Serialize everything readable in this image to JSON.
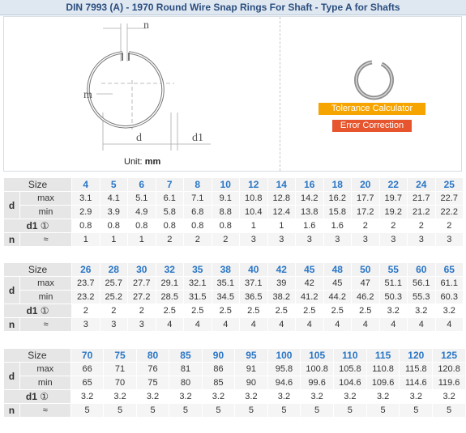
{
  "title": "DIN 7993 (A) - 1970 Round Wire Snap Rings For Shaft - Type A for Shafts",
  "diagram": {
    "labels": [
      "m",
      "n",
      "d",
      "d1"
    ],
    "unit_label": "Unit:",
    "unit_value": "mm"
  },
  "buttons": {
    "tolerance_calculator": "Tolerance Calculator",
    "error_correction": "Error Correction"
  },
  "row_labels": {
    "size": "Size",
    "d": "d",
    "max": "max",
    "min": "min",
    "d1": "d1",
    "d1_note": "①",
    "n": "n",
    "approx": "≈"
  },
  "tables": [
    {
      "size": [
        "4",
        "5",
        "6",
        "7",
        "8",
        "10",
        "12",
        "14",
        "16",
        "18",
        "20",
        "22",
        "24",
        "25"
      ],
      "max": [
        "3.1",
        "4.1",
        "5.1",
        "6.1",
        "7.1",
        "9.1",
        "10.8",
        "12.8",
        "14.2",
        "16.2",
        "17.7",
        "19.7",
        "21.7",
        "22.7"
      ],
      "min": [
        "2.9",
        "3.9",
        "4.9",
        "5.8",
        "6.8",
        "8.8",
        "10.4",
        "12.4",
        "13.8",
        "15.8",
        "17.2",
        "19.2",
        "21.2",
        "22.2"
      ],
      "d1": [
        "0.8",
        "0.8",
        "0.8",
        "0.8",
        "0.8",
        "0.8",
        "1",
        "1",
        "1.6",
        "1.6",
        "2",
        "2",
        "2",
        "2"
      ],
      "n": [
        "1",
        "1",
        "1",
        "2",
        "2",
        "2",
        "3",
        "3",
        "3",
        "3",
        "3",
        "3",
        "3",
        "3"
      ]
    },
    {
      "size": [
        "26",
        "28",
        "30",
        "32",
        "35",
        "38",
        "40",
        "42",
        "45",
        "48",
        "50",
        "55",
        "60",
        "65"
      ],
      "max": [
        "23.7",
        "25.7",
        "27.7",
        "29.1",
        "32.1",
        "35.1",
        "37.1",
        "39",
        "42",
        "45",
        "47",
        "51.1",
        "56.1",
        "61.1"
      ],
      "min": [
        "23.2",
        "25.2",
        "27.2",
        "28.5",
        "31.5",
        "34.5",
        "36.5",
        "38.2",
        "41.2",
        "44.2",
        "46.2",
        "50.3",
        "55.3",
        "60.3"
      ],
      "d1": [
        "2",
        "2",
        "2",
        "2.5",
        "2.5",
        "2.5",
        "2.5",
        "2.5",
        "2.5",
        "2.5",
        "2.5",
        "3.2",
        "3.2",
        "3.2"
      ],
      "n": [
        "3",
        "3",
        "3",
        "4",
        "4",
        "4",
        "4",
        "4",
        "4",
        "4",
        "4",
        "4",
        "4",
        "4"
      ]
    },
    {
      "size": [
        "70",
        "75",
        "80",
        "85",
        "90",
        "95",
        "100",
        "105",
        "110",
        "115",
        "120",
        "125"
      ],
      "max": [
        "66",
        "71",
        "76",
        "81",
        "86",
        "91",
        "95.8",
        "100.8",
        "105.8",
        "110.8",
        "115.8",
        "120.8"
      ],
      "min": [
        "65",
        "70",
        "75",
        "80",
        "85",
        "90",
        "94.6",
        "99.6",
        "104.6",
        "109.6",
        "114.6",
        "119.6"
      ],
      "d1": [
        "3.2",
        "3.2",
        "3.2",
        "3.2",
        "3.2",
        "3.2",
        "3.2",
        "3.2",
        "3.2",
        "3.2",
        "3.2",
        "3.2"
      ],
      "n": [
        "5",
        "5",
        "5",
        "5",
        "5",
        "5",
        "5",
        "5",
        "5",
        "5",
        "5",
        "5"
      ]
    }
  ]
}
